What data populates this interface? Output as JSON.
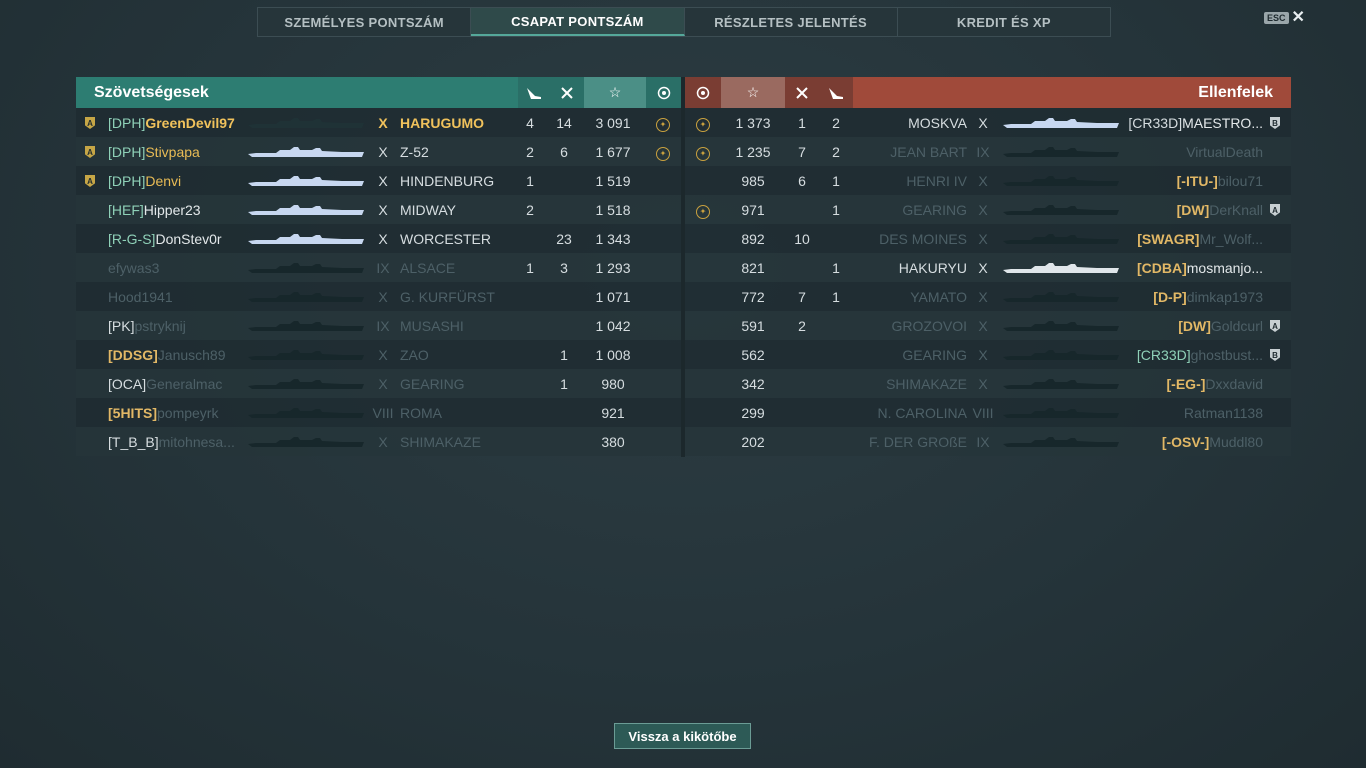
{
  "tabs": [
    {
      "label": "SZEMÉLYES PONTSZÁM"
    },
    {
      "label": "CSAPAT PONTSZÁM"
    },
    {
      "label": "RÉSZLETES JELENTÉS"
    },
    {
      "label": "KREDIT ÉS XP"
    }
  ],
  "esc": {
    "key_label": "ESC",
    "close_glyph": "✕"
  },
  "allies": {
    "title": "Szövetségesek",
    "header_icons": [
      "torpedo-hit-icon",
      "kill-icon",
      "star-icon",
      "medal-icon"
    ],
    "rows": [
      {
        "badge": "A",
        "clan": "[DPH]",
        "name": "GreenDevil97",
        "tier": "X",
        "ship": "HARUGUMO",
        "c1": "4",
        "c2": "14",
        "score": "3 091",
        "medal": true,
        "style": "self"
      },
      {
        "badge": "A",
        "clan": "[DPH]",
        "name": "Stivpapa",
        "tier": "X",
        "ship": "Z-52",
        "c1": "2",
        "c2": "6",
        "score": "1 677",
        "medal": true,
        "style": "div"
      },
      {
        "badge": "A",
        "clan": "[DPH]",
        "name": "Denvi",
        "tier": "X",
        "ship": "HINDENBURG",
        "c1": "1",
        "c2": "",
        "score": "1 519",
        "medal": false,
        "style": "div"
      },
      {
        "badge": "",
        "clan": "[HEF]",
        "name": "Hipper23",
        "tier": "X",
        "ship": "MIDWAY",
        "c1": "2",
        "c2": "",
        "score": "1 518",
        "medal": false,
        "style": "alive"
      },
      {
        "badge": "",
        "clan": "[R-G-S]",
        "name": "DonStev0r",
        "tier": "X",
        "ship": "WORCESTER",
        "c1": "",
        "c2": "23",
        "score": "1 343",
        "medal": false,
        "style": "alive"
      },
      {
        "badge": "",
        "clan": "",
        "name": "efywas3",
        "tier": "IX",
        "ship": "ALSACE",
        "c1": "1",
        "c2": "3",
        "score": "1 293",
        "medal": false,
        "style": "dead"
      },
      {
        "badge": "",
        "clan": "",
        "name": "Hood1941",
        "tier": "X",
        "ship": "G. KURFÜRST",
        "c1": "",
        "c2": "",
        "score": "1 071",
        "medal": false,
        "style": "dead"
      },
      {
        "badge": "",
        "clan": "[PK]",
        "name": "pstryknij",
        "tier": "IX",
        "ship": "MUSASHI",
        "c1": "",
        "c2": "",
        "score": "1 042",
        "medal": false,
        "style": "dead"
      },
      {
        "badge": "",
        "clan": "[DDSG]",
        "name": "Janusch89",
        "tier": "X",
        "ship": "ZAO",
        "c1": "",
        "c2": "1",
        "score": "1 008",
        "medal": false,
        "style": "dead-gold"
      },
      {
        "badge": "",
        "clan": "[OCA]",
        "name": "Generalmac",
        "tier": "X",
        "ship": "GEARING",
        "c1": "",
        "c2": "1",
        "score": "980",
        "medal": false,
        "style": "dead"
      },
      {
        "badge": "",
        "clan": "[5HITS]",
        "name": "pompeyrk",
        "tier": "VIII",
        "ship": "ROMA",
        "c1": "",
        "c2": "",
        "score": "921",
        "medal": false,
        "style": "dead-gold"
      },
      {
        "badge": "",
        "clan": "[T_B_B]",
        "name": "mitohnesa...",
        "tier": "X",
        "ship": "SHIMAKAZE",
        "c1": "",
        "c2": "",
        "score": "380",
        "medal": false,
        "style": "dead"
      }
    ]
  },
  "enemies": {
    "title": "Ellenfelek",
    "header_icons": [
      "medal-icon",
      "star-icon",
      "kill-icon",
      "torpedo-hit-icon"
    ],
    "rows": [
      {
        "badge": "B",
        "clan": "[CR33D]",
        "name": "MAESTRO...",
        "tier": "X",
        "ship": "MOSKVA",
        "c1": "2",
        "c2": "1",
        "score": "1 373",
        "medal": true,
        "style": "alive"
      },
      {
        "badge": "",
        "clan": "",
        "name": "VirtualDeath",
        "tier": "IX",
        "ship": "JEAN BART",
        "c1": "2",
        "c2": "7",
        "score": "1 235",
        "medal": true,
        "style": "dead"
      },
      {
        "badge": "",
        "clan": "[-ITU-]",
        "name": "bilou71",
        "tier": "X",
        "ship": "HENRI IV",
        "c1": "1",
        "c2": "6",
        "score": "985",
        "medal": false,
        "style": "dead-gold"
      },
      {
        "badge": "A",
        "clan": "[DW]",
        "name": "DerKnall",
        "tier": "X",
        "ship": "GEARING",
        "c1": "1",
        "c2": "",
        "score": "971",
        "medal": true,
        "style": "dead-gold"
      },
      {
        "badge": "",
        "clan": "[SWAGR]",
        "name": "Mr_Wolf...",
        "tier": "X",
        "ship": "DES MOINES",
        "c1": "",
        "c2": "10",
        "score": "892",
        "medal": false,
        "style": "dead-gold"
      },
      {
        "badge": "",
        "clan": "[CDBA]",
        "name": "mosmanjo...",
        "tier": "X",
        "ship": "HAKURYU",
        "c1": "1",
        "c2": "",
        "score": "821",
        "medal": false,
        "style": "alive-gold"
      },
      {
        "badge": "",
        "clan": "[D-P]",
        "name": "dimkap1973",
        "tier": "X",
        "ship": "YAMATO",
        "c1": "1",
        "c2": "7",
        "score": "772",
        "medal": false,
        "style": "dead-gold"
      },
      {
        "badge": "A",
        "clan": "[DW]",
        "name": "Goldcurl",
        "tier": "X",
        "ship": "GROZOVOI",
        "c1": "",
        "c2": "2",
        "score": "591",
        "medal": false,
        "style": "dead-gold"
      },
      {
        "badge": "B",
        "clan": "[CR33D]",
        "name": "ghostbust...",
        "tier": "X",
        "ship": "GEARING",
        "c1": "",
        "c2": "",
        "score": "562",
        "medal": false,
        "style": "dead-green"
      },
      {
        "badge": "",
        "clan": "[-EG-]",
        "name": "Dxxdavid",
        "tier": "X",
        "ship": "SHIMAKAZE",
        "c1": "",
        "c2": "",
        "score": "342",
        "medal": false,
        "style": "dead-gold"
      },
      {
        "badge": "",
        "clan": "",
        "name": "Ratman1138",
        "tier": "VIII",
        "ship": "N. CAROLINA",
        "c1": "",
        "c2": "",
        "score": "299",
        "medal": false,
        "style": "dead"
      },
      {
        "badge": "",
        "clan": "[-OSV-]",
        "name": "Muddl80",
        "tier": "IX",
        "ship": "F. DER GROßE",
        "c1": "",
        "c2": "",
        "score": "202",
        "medal": false,
        "style": "dead-gold"
      }
    ]
  },
  "footer": {
    "back_label": "Vissza a kikötőbe"
  },
  "colors": {
    "ally_header": "#2d7d72",
    "enemy_header": "#a04a3a",
    "gold": "#f0c25c",
    "clan_green": "#8fd1b8",
    "dead_text": "#4d6067"
  }
}
